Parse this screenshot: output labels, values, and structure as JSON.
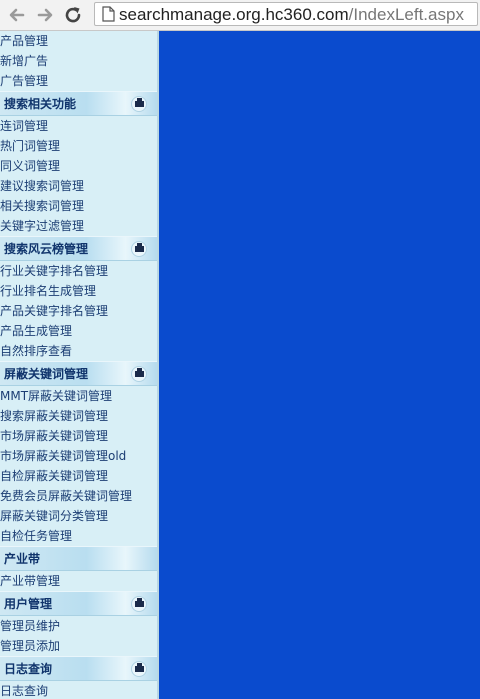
{
  "browser": {
    "url_host": "searchmanage.org.hc360.com",
    "url_path": "/IndexLeft.aspx"
  },
  "menu": {
    "top_items": [
      "产品管理",
      "新增广告",
      "广告管理"
    ],
    "sections": [
      {
        "title": "搜索相关功能",
        "badge": true,
        "items": [
          "连词管理",
          "热门词管理",
          "同义词管理",
          "建议搜索词管理",
          "相关搜索词管理",
          "关键字过滤管理"
        ]
      },
      {
        "title": "搜索风云榜管理",
        "badge": true,
        "items": [
          "行业关键字排名管理",
          "行业排名生成管理",
          "产品关键字排名管理",
          "产品生成管理",
          "自然排序查看"
        ]
      },
      {
        "title": "屏蔽关键词管理",
        "badge": true,
        "items": [
          "MMT屏蔽关键词管理",
          "搜索屏蔽关键词管理",
          "市场屏蔽关键词管理",
          "市场屏蔽关键词管理old",
          "自检屏蔽关键词管理",
          "免费会员屏蔽关键词管理",
          "屏蔽关键词分类管理",
          "自检任务管理"
        ]
      },
      {
        "title": "产业带",
        "badge": false,
        "items": [
          "产业带管理"
        ]
      },
      {
        "title": "用户管理",
        "badge": true,
        "items": [
          "管理员维护",
          "管理员添加"
        ]
      },
      {
        "title": "日志查询",
        "badge": true,
        "items": [
          "日志查询"
        ]
      }
    ]
  },
  "colors": {
    "right_frame": "#0a4bce",
    "left_frame": "#d8eff6",
    "menu_text": "#1c3e74",
    "section_text": "#10346c"
  }
}
